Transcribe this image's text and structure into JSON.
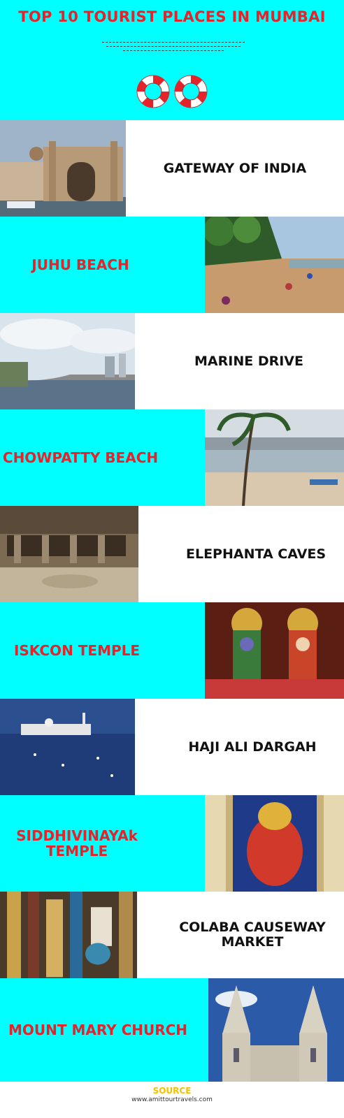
{
  "header": {
    "title": "TOP 10 TOURIST PLACES IN MUMBAI"
  },
  "places": [
    {
      "name": "GATEWAY OF INDIA"
    },
    {
      "name": "JUHU BEACH"
    },
    {
      "name": "MARINE DRIVE"
    },
    {
      "name": "CHOWPATTY BEACH"
    },
    {
      "name": "ELEPHANTA CAVES"
    },
    {
      "name": "ISKCON TEMPLE"
    },
    {
      "name": "HAJI ALI DARGAH"
    },
    {
      "name": "SIDDHIVINAYAk TEMPLE"
    },
    {
      "name": "COLABA CAUSEWAY MARKET"
    },
    {
      "name": "MOUNT MARY CHURCH"
    }
  ],
  "footer": {
    "source_label": "SOURCE",
    "website": "www.amittourtravels.com"
  },
  "colors": {
    "accent_cyan": "#00ffff",
    "title_red": "#e3242b",
    "source_yellow": "#f2c200"
  }
}
